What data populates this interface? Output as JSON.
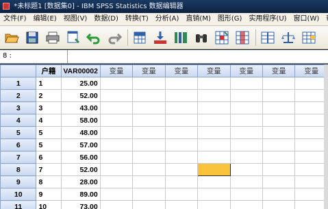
{
  "window": {
    "title": "*未标题1 [数据集0] - IBM SPSS Statistics 数据编辑器"
  },
  "menu": [
    "文件(F)",
    "编辑(E)",
    "视图(V)",
    "数据(D)",
    "转换(T)",
    "分析(A)",
    "直销(M)",
    "图形(G)",
    "实用程序(U)",
    "窗口(W)",
    "帮助"
  ],
  "toolbar": {
    "icons": [
      "open-folder-icon",
      "save-icon",
      "print-icon",
      "recall-dialog-icon",
      "undo-icon",
      "redo-icon",
      "goto-case-icon",
      "goto-variable-icon",
      "variables-icon",
      "find-icon",
      "insert-cases-icon",
      "insert-variable-icon",
      "split-file-icon",
      "weight-cases-icon",
      "select-cases-icon"
    ]
  },
  "cell_ref": {
    "label": "8 :",
    "value": ""
  },
  "grid": {
    "columns": [
      "户籍",
      "VAR00002",
      "变量",
      "变量",
      "变量",
      "变量",
      "变量",
      "变量",
      "变量"
    ],
    "rows": [
      {
        "num": "1",
        "c1": "1",
        "c2": "25.00"
      },
      {
        "num": "2",
        "c1": "2",
        "c2": "52.00"
      },
      {
        "num": "3",
        "c1": "3",
        "c2": "43.00"
      },
      {
        "num": "4",
        "c1": "4",
        "c2": "58.00"
      },
      {
        "num": "5",
        "c1": "5",
        "c2": "48.00"
      },
      {
        "num": "6",
        "c1": "5",
        "c2": "57.00"
      },
      {
        "num": "7",
        "c1": "6",
        "c2": "56.00"
      },
      {
        "num": "8",
        "c1": "7",
        "c2": "52.00"
      },
      {
        "num": "9",
        "c1": "8",
        "c2": "28.00"
      },
      {
        "num": "10",
        "c1": "9",
        "c2": "89.00"
      },
      {
        "num": "11",
        "c1": "10",
        "c2": "73.00"
      }
    ],
    "selected": {
      "row": "8",
      "column": 5
    }
  },
  "colors": {
    "selected_cell": "#f8c23a",
    "header_bg": "#d6e2f5"
  }
}
